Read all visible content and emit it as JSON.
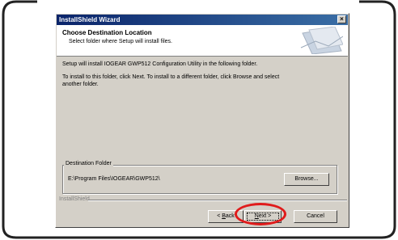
{
  "window": {
    "title": "InstallShield Wizard",
    "close_glyph": "×"
  },
  "header": {
    "title": "Choose Destination Location",
    "subtitle": "Select folder where Setup will install files."
  },
  "body": {
    "line1": "Setup will install IOGEAR GWP512 Configuration Utility in the following folder.",
    "line2": "To install to this folder, click Next. To install to a different folder, click Browse and select",
    "line3": "another folder."
  },
  "destination": {
    "legend": "Destination Folder",
    "path": "E:\\Program Files\\IOGEAR\\GWP512\\",
    "browse_label": "Browse..."
  },
  "footer": {
    "brand": "InstallShield",
    "back_prefix": "< ",
    "back_hotkey": "B",
    "back_rest": "ack",
    "next_hotkey": "N",
    "next_rest": "ext >",
    "cancel_label": "Cancel"
  },
  "annotation": {
    "color": "#e01b1b"
  }
}
